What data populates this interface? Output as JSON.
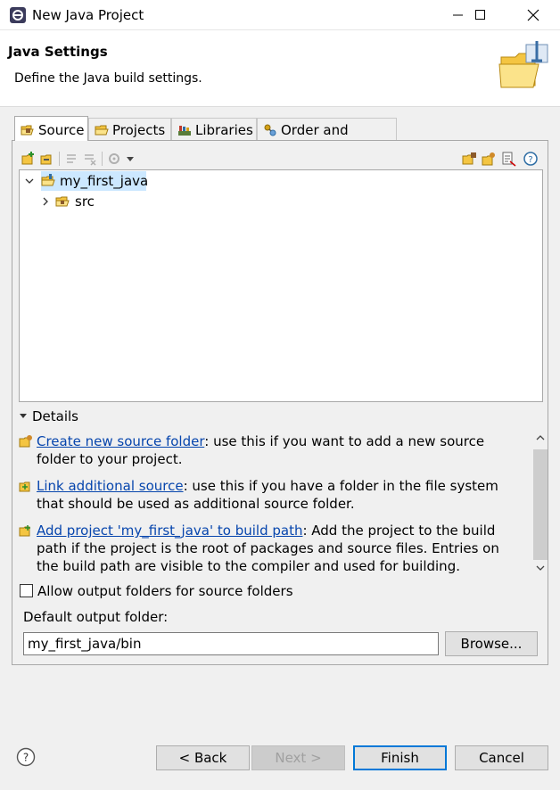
{
  "window": {
    "title": "New Java Project"
  },
  "header": {
    "title": "Java Settings",
    "description": "Define the Java build settings."
  },
  "tabs": [
    {
      "label": "Source",
      "icon": "source-folder-icon",
      "active": true
    },
    {
      "label": "Projects",
      "icon": "projects-icon",
      "active": false
    },
    {
      "label": "Libraries",
      "icon": "libraries-icon",
      "active": false
    },
    {
      "label": "Order and Export",
      "icon": "order-export-icon",
      "active": false
    }
  ],
  "tree": {
    "items": [
      {
        "label": "my_first_java",
        "expanded": true,
        "selected": true,
        "icon": "java-project-icon"
      },
      {
        "label": "src",
        "expanded": false,
        "selected": false,
        "icon": "package-folder-icon"
      }
    ]
  },
  "details": {
    "heading": "Details",
    "items": [
      {
        "link": "Create new source folder",
        "text": ": use this if you want to add a new source folder to your project."
      },
      {
        "link": "Link additional source",
        "text": ": use this if you have a folder in the file system that should be used as additional source folder."
      },
      {
        "link": "Add project 'my_first_java' to build path",
        "text": ": Add the project to the build path if the project is the root of packages and source files. Entries on the build path are visible to the compiler and used for building."
      }
    ]
  },
  "options": {
    "allow_output_label": "Allow output folders for source folders",
    "allow_output_checked": false,
    "default_output_label": "Default output folder:",
    "default_output_value": "my_first_java/bin",
    "browse_label": "Browse..."
  },
  "buttons": {
    "back": "< Back",
    "next": "Next >",
    "finish": "Finish",
    "cancel": "Cancel"
  },
  "colors": {
    "link": "#0645ad",
    "selection": "#cce8ff",
    "default_button_border": "#0078d7"
  }
}
